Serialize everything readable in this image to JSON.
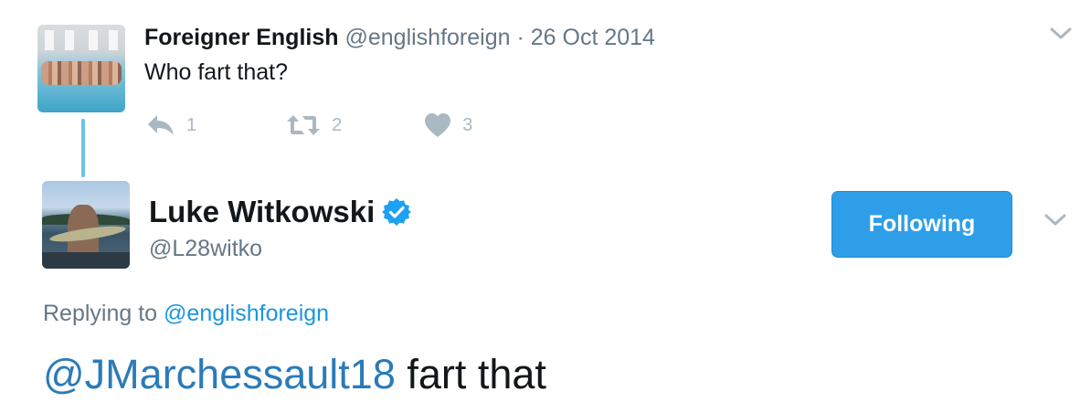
{
  "parent_tweet": {
    "author_name": "Foreigner English",
    "author_handle": "@englishforeign",
    "separator": " · ",
    "date": "26 Oct 2014",
    "text": "Who fart that?",
    "reply_count": "1",
    "retweet_count": "2",
    "like_count": "3"
  },
  "main_tweet": {
    "author_name": "Luke Witkowski",
    "author_handle": "@L28witko",
    "verified": true,
    "follow_label": "Following",
    "replying_prefix": "Replying to ",
    "replying_to": "@englishforeign",
    "mention": "@JMarchessault18",
    "text": " fart that"
  },
  "icons": {
    "reply": "reply-icon",
    "retweet": "retweet-icon",
    "like": "heart-icon",
    "verified": "verified-badge-icon",
    "menu": "chevron-down-icon"
  },
  "colors": {
    "accent": "#1b95e0",
    "follow_button": "#2e9ee8",
    "muted": "#657786",
    "action_icons": "#aab8c2",
    "thread_line": "#6ec3e8"
  }
}
